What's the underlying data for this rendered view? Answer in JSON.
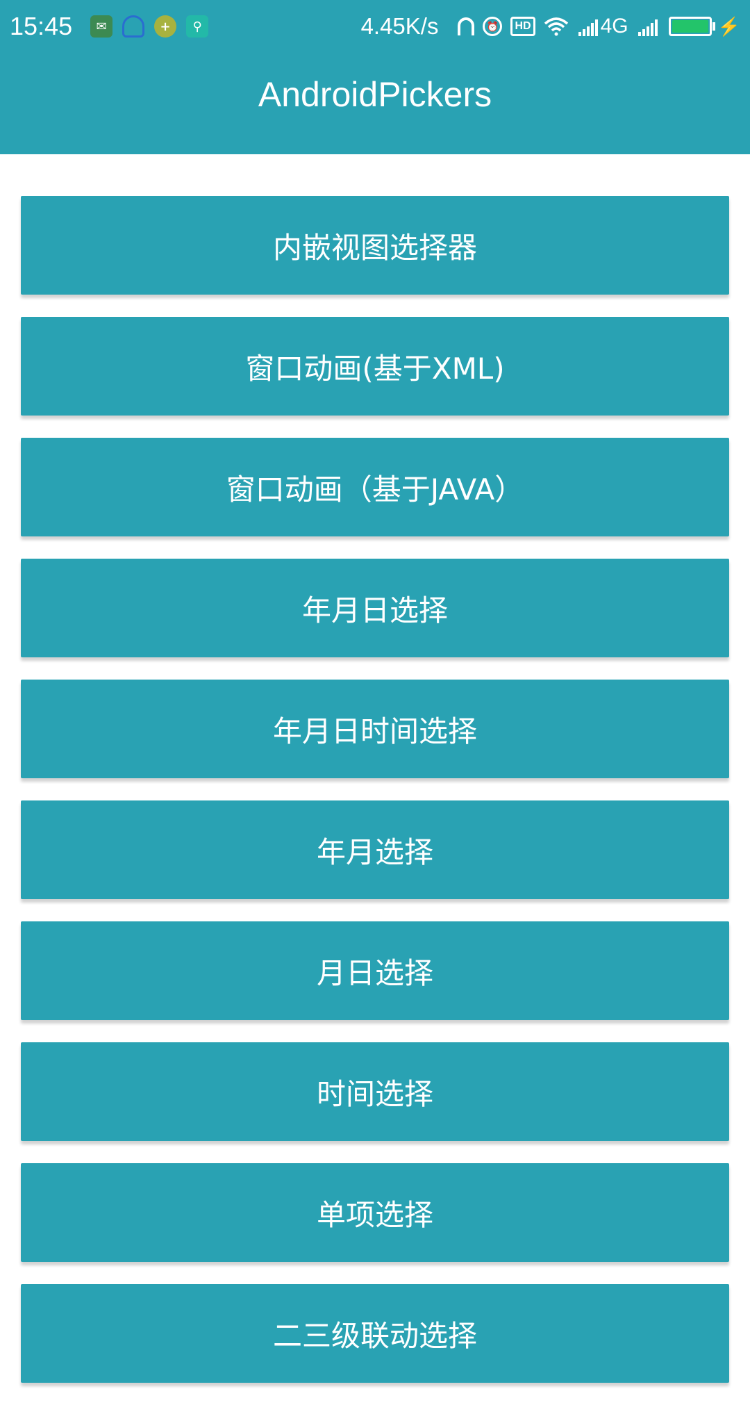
{
  "status_bar": {
    "time": "15:45",
    "network_speed": "4.45K/s",
    "hd_label": "HD",
    "network_type": "4G",
    "icons": [
      "wechat-icon",
      "headset-icon",
      "plus-icon",
      "usb-icon",
      "headphones-icon",
      "alarm-icon",
      "hd-icon",
      "wifi-icon",
      "signal-icon",
      "battery-icon",
      "charging-icon"
    ],
    "battery_level": 1.0,
    "battery_color": "#23c46a"
  },
  "app_bar": {
    "title": "AndroidPickers"
  },
  "colors": {
    "primary": "#29a2b3",
    "background": "#ffffff",
    "text_on_primary": "#ffffff"
  },
  "buttons": [
    {
      "label": "内嵌视图选择器"
    },
    {
      "label": "窗口动画(基于XML)"
    },
    {
      "label": "窗口动画（基于JAVA）"
    },
    {
      "label": "年月日选择"
    },
    {
      "label": "年月日时间选择"
    },
    {
      "label": "年月选择"
    },
    {
      "label": "月日选择"
    },
    {
      "label": "时间选择"
    },
    {
      "label": "单项选择"
    },
    {
      "label": "二三级联动选择"
    }
  ]
}
